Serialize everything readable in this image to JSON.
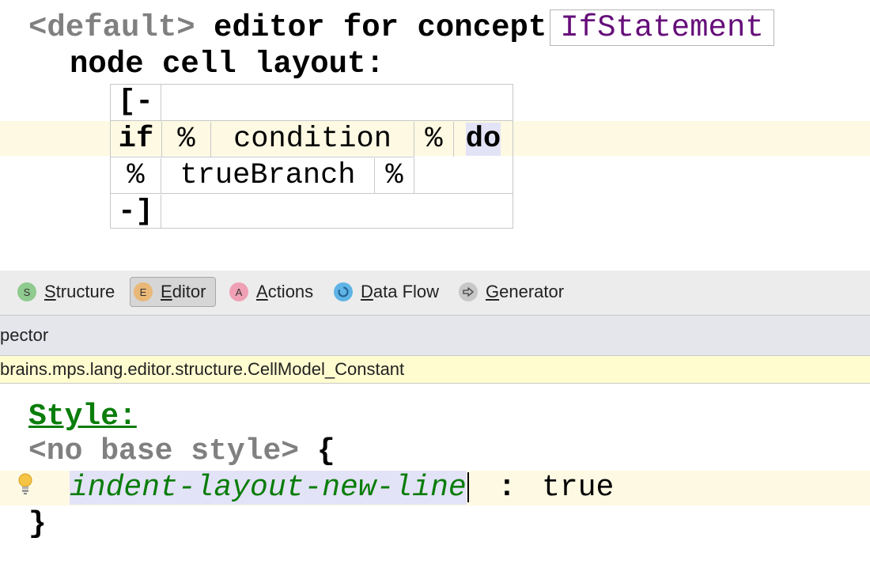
{
  "editor": {
    "header": {
      "default_label": "<default>",
      "editor_for_concept": "editor for concept",
      "concept_name": "IfStatement"
    },
    "layout_line": "node cell layout:",
    "cells": {
      "open": "[-",
      "if": "if",
      "pct1": "%",
      "condition": "condition",
      "pct2": "%",
      "do": "do",
      "pct3": "%",
      "true_branch": "trueBranch",
      "pct4": "%",
      "close": "-]"
    }
  },
  "tabs": [
    {
      "icon_letter": "S",
      "prefix": "S",
      "rest": "tructure",
      "color": "#8fca8f"
    },
    {
      "icon_letter": "E",
      "prefix": "E",
      "rest": "ditor",
      "color": "#e9b777",
      "active": true
    },
    {
      "icon_letter": "A",
      "prefix": "A",
      "rest": "ctions",
      "color": "#f0a0b4"
    },
    {
      "icon_letter": "",
      "prefix": "D",
      "rest": "ata Flow",
      "color": "#5fb3e6"
    },
    {
      "icon_letter": "",
      "prefix": "G",
      "rest": "enerator",
      "color": "#b9b9b9"
    }
  ],
  "inspector": {
    "title": "pector",
    "path": "brains.mps.lang.editor.structure.CellModel_Constant",
    "style_title": "Style:",
    "base_style": "<no base style>",
    "open_brace": "{",
    "property_name": "indent-layout-new-line",
    "property_sep": ":",
    "property_value": "true",
    "close_brace": "}"
  },
  "colors": {
    "keyword_gray": "#808080",
    "concept_purple": "#660e7a",
    "style_green": "#0a7d0a",
    "current_line": "#fdf9e3",
    "selection": "#e3e3f7",
    "path_bar": "#fffcd0"
  }
}
